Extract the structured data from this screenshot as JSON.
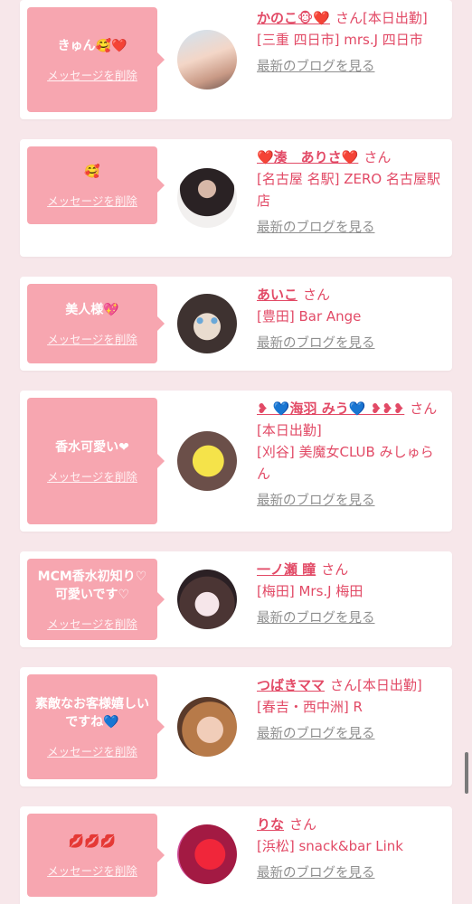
{
  "cards": [
    {
      "message": "きゅん🥰❤️",
      "delete_label": "メッセージを削除",
      "name": "かのこ🐵❤️",
      "san": "さん",
      "status": "[本日出勤]",
      "shop": "[三重 四日市] mrs.J 四日市",
      "blog": "最新のブログを見る"
    },
    {
      "message": "🥰",
      "delete_label": "メッセージを削除",
      "name": "❤️湊　ありさ❤️",
      "san": "さん",
      "status": "",
      "shop": "[名古屋 名駅] ZERO 名古屋駅店",
      "blog": "最新のブログを見る"
    },
    {
      "message": "美人様💖",
      "delete_label": "メッセージを削除",
      "name": "あいこ",
      "san": "さん",
      "status": "",
      "shop": "[豊田] Bar Ange",
      "blog": "最新のブログを見る"
    },
    {
      "message": "香水可愛い❤",
      "delete_label": "メッセージを削除",
      "name": "❥ 💙海羽 みう💙 ❥❥❥",
      "san": "さん",
      "status": "[本日出勤]",
      "shop": "[刈谷] 美魔女CLUB みしゅらん",
      "blog": "最新のブログを見る"
    },
    {
      "message": "MCM香水初知り♡\n可愛いです♡",
      "delete_label": "メッセージを削除",
      "name": "一ノ瀬 瞳",
      "san": "さん",
      "status": "",
      "shop": "[梅田] Mrs.J 梅田",
      "blog": "最新のブログを見る"
    },
    {
      "message": "素敵なお客様嬉しいですね💙",
      "delete_label": "メッセージを削除",
      "name": "つばきママ",
      "san": "さん",
      "status": "[本日出勤]",
      "shop": "[春吉・西中洲] R",
      "blog": "最新のブログを見る"
    },
    {
      "message": "💋💋💋",
      "delete_label": "メッセージを削除",
      "name": "りな",
      "san": "さん",
      "status": "",
      "shop": "[浜松] snack&bar Link",
      "blog": "最新のブログを見る"
    }
  ]
}
